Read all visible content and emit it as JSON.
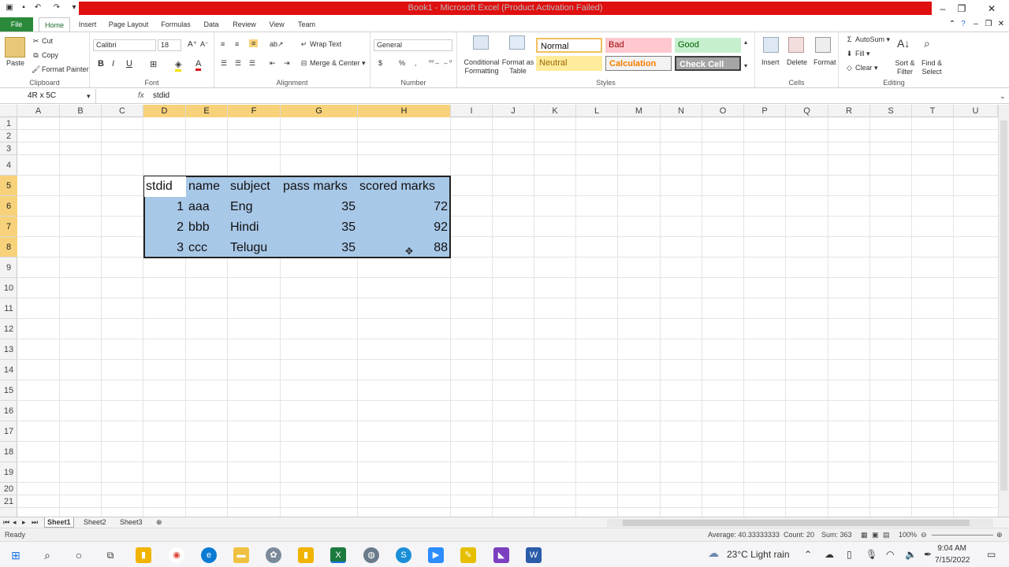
{
  "window": {
    "title": "Book1 - Microsoft Excel (Product Activation Failed)"
  },
  "tabs": [
    "File",
    "Home",
    "Insert",
    "Page Layout",
    "Formulas",
    "Data",
    "Review",
    "View",
    "Team"
  ],
  "clipboard": {
    "paste": "Paste",
    "cut": "Cut",
    "copy": "Copy",
    "format_painter": "Format Painter",
    "label": "Clipboard"
  },
  "font": {
    "name": "Calibri",
    "size": "18",
    "label": "Font",
    "bold": "B",
    "italic": "I",
    "underline": "U"
  },
  "alignment": {
    "wrap": "Wrap Text",
    "merge": "Merge & Center",
    "label": "Alignment"
  },
  "number": {
    "format": "General",
    "label": "Number",
    "currency": "$",
    "percent": "%",
    "comma": ","
  },
  "styles": {
    "conditional": "Conditional Formatting",
    "format_table": "Format as Table",
    "normal": "Normal",
    "bad": "Bad",
    "good": "Good",
    "neutral": "Neutral",
    "calculation": "Calculation",
    "check": "Check Cell",
    "label": "Styles"
  },
  "cells_group": {
    "insert": "Insert",
    "delete": "Delete",
    "format": "Format",
    "label": "Cells"
  },
  "editing": {
    "autosum": "AutoSum",
    "fill": "Fill",
    "clear": "Clear",
    "sort": "Sort & Filter",
    "find": "Find & Select",
    "label": "Editing"
  },
  "formula_bar": {
    "name_box": "4R x 5C",
    "fx": "fx",
    "content": "stdid"
  },
  "columns": [
    "A",
    "B",
    "C",
    "D",
    "E",
    "F",
    "G",
    "H",
    "I",
    "J",
    "K",
    "L",
    "M",
    "N",
    "O",
    "P",
    "Q",
    "R",
    "S",
    "T",
    "U"
  ],
  "rows": [
    "1",
    "2",
    "3",
    "4",
    "5",
    "6",
    "7",
    "8",
    "9",
    "10",
    "11",
    "12",
    "13",
    "14",
    "15",
    "16",
    "17",
    "18",
    "19",
    "20",
    "21"
  ],
  "table": {
    "headers": [
      "stdid",
      "name",
      "subject",
      "pass marks",
      "scored marks"
    ],
    "rows": [
      [
        "1",
        "aaa",
        "Eng",
        "35",
        "72"
      ],
      [
        "2",
        "bbb",
        "Hindi",
        "35",
        "92"
      ],
      [
        "3",
        "ccc",
        "Telugu",
        "35",
        "88"
      ]
    ]
  },
  "sheets": [
    "Sheet1",
    "Sheet2",
    "Sheet3"
  ],
  "status": {
    "ready": "Ready",
    "average": "Average: 40.33333333",
    "count": "Count: 20",
    "sum": "Sum: 363",
    "zoom": "100%"
  },
  "taskbar": {
    "weather": "23°C  Light rain",
    "time": "9:04 AM",
    "date": "7/15/2022"
  },
  "colors": {
    "title_bar": "#e01010",
    "file_tab": "#2a8a3a",
    "selection": "#a8c8e8",
    "header_highlight": "#f8d27a"
  }
}
